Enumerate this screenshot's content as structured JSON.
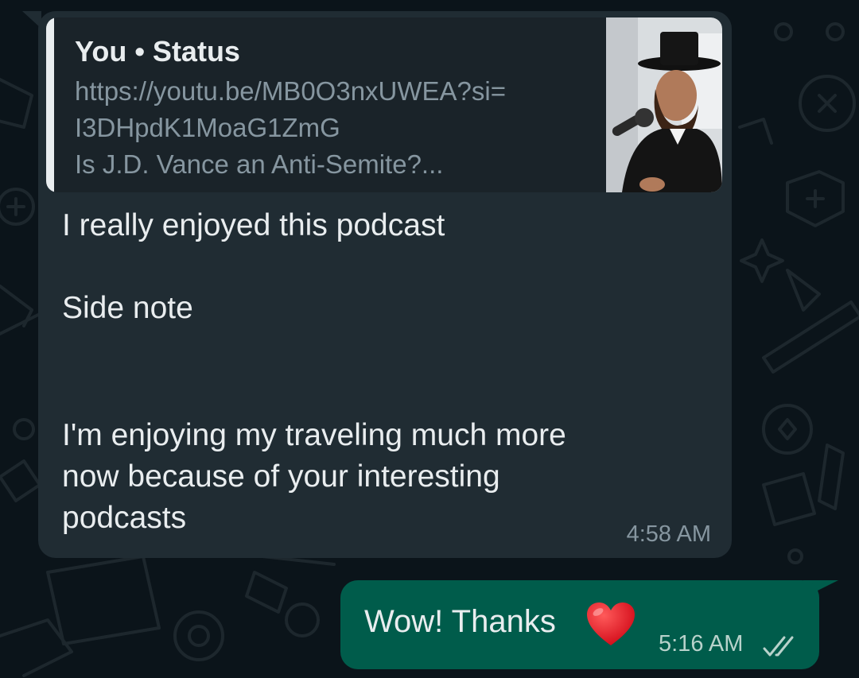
{
  "theme": {
    "background": "#0b141a",
    "incoming_bubble": "#202c33",
    "outgoing_bubble": "#005c4b",
    "text_primary": "#e9edef",
    "text_secondary": "#8696a0"
  },
  "incoming_message": {
    "quoted_status": {
      "title": "You • Status",
      "link_line1": "https://youtu.be/MB0O3nxUWEA?si=",
      "link_line2": "I3DHpdK1MoaG1ZmG",
      "video_title": "Is J.D. Vance an Anti-Semite?...",
      "thumbnail_icon": "video-thumbnail-person-in-black-hat"
    },
    "lines": {
      "line1": "I really enjoyed this podcast",
      "line2": "Side note",
      "line3": "I'm enjoying my traveling much more",
      "line4": "now because of your interesting",
      "line5": "podcasts"
    },
    "time": "4:58 AM"
  },
  "outgoing_message": {
    "text": "Wow! Thanks",
    "emoji_icon": "red-heart-icon",
    "time": "5:16 AM",
    "status_icon": "double-check-read-icon"
  }
}
